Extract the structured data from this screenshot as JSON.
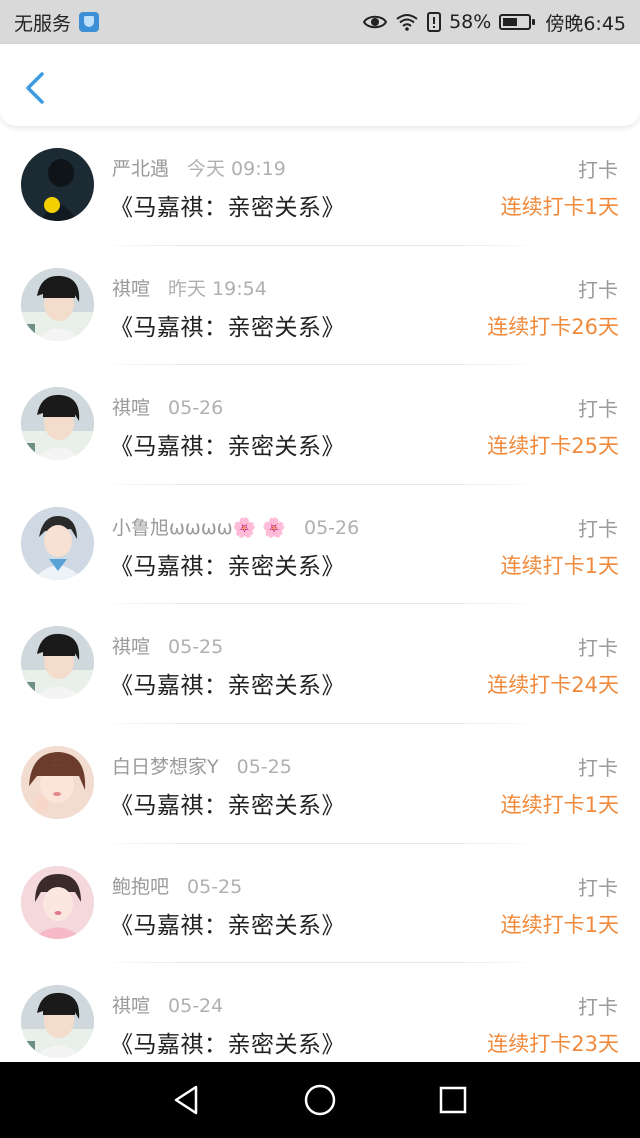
{
  "status_bar": {
    "carrier": "无服务",
    "battery_percent": "58%",
    "battery_level": 0.58,
    "time": "傍晚6:45",
    "icons": [
      "shield-icon",
      "eye-icon",
      "wifi-icon",
      "alert-icon",
      "battery-icon"
    ]
  },
  "header": {
    "back_icon": "chevron-left-icon"
  },
  "colors": {
    "accent": "#3b9be0",
    "streak": "#f08a3c",
    "muted": "#9a9a9a"
  },
  "entries": [
    {
      "user": "严北遇",
      "time": "今天 09:19",
      "title": "《马嘉祺：亲密关系》",
      "action": "打卡",
      "streak": "连续打卡1天",
      "avatar": "dark"
    },
    {
      "user": "祺喧",
      "time": "昨天 19:54",
      "title": "《马嘉祺：亲密关系》",
      "action": "打卡",
      "streak": "连续打卡26天",
      "avatar": "boy"
    },
    {
      "user": "祺喧",
      "time": "05-26",
      "title": "《马嘉祺：亲密关系》",
      "action": "打卡",
      "streak": "连续打卡25天",
      "avatar": "boy"
    },
    {
      "user": "小鲁旭ωωωω🌸 🌸",
      "time": "05-26",
      "title": "《马嘉祺：亲密关系》",
      "action": "打卡",
      "streak": "连续打卡1天",
      "avatar": "blue"
    },
    {
      "user": "祺喧",
      "time": "05-25",
      "title": "《马嘉祺：亲密关系》",
      "action": "打卡",
      "streak": "连续打卡24天",
      "avatar": "boy"
    },
    {
      "user": "白日梦想家Y",
      "time": "05-25",
      "title": "《马嘉祺：亲密关系》",
      "action": "打卡",
      "streak": "连续打卡1天",
      "avatar": "girl"
    },
    {
      "user": "鲍抱吧",
      "time": "05-25",
      "title": "《马嘉祺：亲密关系》",
      "action": "打卡",
      "streak": "连续打卡1天",
      "avatar": "pink"
    },
    {
      "user": "祺喧",
      "time": "05-24",
      "title": "《马嘉祺：亲密关系》",
      "action": "打卡",
      "streak": "连续打卡23天",
      "avatar": "boy"
    }
  ],
  "nav_bar": {
    "icons": [
      "back-triangle-icon",
      "home-circle-icon",
      "recents-square-icon"
    ]
  }
}
